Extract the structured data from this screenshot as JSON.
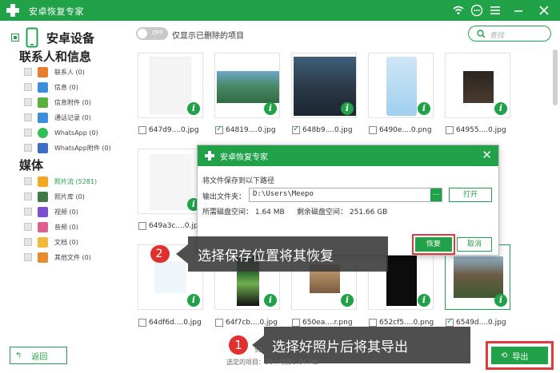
{
  "app": {
    "title": "安卓恢复专家"
  },
  "titlebar": {
    "icons": [
      "wifi-icon",
      "chat-icon",
      "menu-icon",
      "minimize-icon",
      "close-icon"
    ]
  },
  "sidebar": {
    "device_label": "安卓设备",
    "section1": "联系人和信息",
    "section2": "媒体",
    "contacts_items": [
      {
        "label": "联系人 (0)",
        "icon": "contacts-icon"
      },
      {
        "label": "信息 (0)",
        "icon": "message-icon"
      },
      {
        "label": "信息附件 (0)",
        "icon": "attachment-icon"
      },
      {
        "label": "通话记录 (0)",
        "icon": "call-log-icon"
      },
      {
        "label": "WhatsApp (0)",
        "icon": "whatsapp-icon"
      },
      {
        "label": "WhatsApp附件 (0)",
        "icon": "whatsapp-attachment-icon"
      }
    ],
    "media_items": [
      {
        "label": "照片流 (5281)",
        "icon": "photo-stream-icon"
      },
      {
        "label": "照片库 (0)",
        "icon": "photo-library-icon"
      },
      {
        "label": "视频 (0)",
        "icon": "video-icon"
      },
      {
        "label": "音频 (0)",
        "icon": "audio-icon"
      },
      {
        "label": "文档 (0)",
        "icon": "document-icon"
      },
      {
        "label": "其他文件 (0)",
        "icon": "other-files-icon"
      }
    ]
  },
  "filter": {
    "toggle_text": "OFF",
    "label": "仅显示已删除的项目"
  },
  "search": {
    "placeholder": "查找"
  },
  "thumbnails": [
    {
      "caption": "647d9....0.jpg",
      "checked": false
    },
    {
      "caption": "64819....0.jpg",
      "checked": true
    },
    {
      "caption": "648b9....0.jpg",
      "checked": true
    },
    {
      "caption": "6490e....0.png",
      "checked": false
    },
    {
      "caption": "64955....0.jpg",
      "checked": false
    },
    {
      "caption": "649a3c....0.jpg",
      "checked": false
    },
    {
      "caption": "64df6d....0.jpg",
      "checked": false
    },
    {
      "caption": "64f7cb....0.jpg",
      "checked": false
    },
    {
      "caption": "650ea....r.png",
      "checked": false
    },
    {
      "caption": "652cf5....0.png",
      "checked": false
    },
    {
      "caption": "6549d....0.jpg",
      "checked": true
    }
  ],
  "dialog": {
    "title": "安卓恢复专家",
    "prompt": "将文件保存到以下路径",
    "folder_label": "输出文件夹：",
    "folder_value": "D:\\Users\\Meepo",
    "browse_label": "...",
    "open_label": "打开",
    "required_space": "所需磁盘空间： 1.64 MB",
    "free_space": "剩余磁盘空间： 251.66 GB",
    "restore_label": "恢复",
    "cancel_label": "取消"
  },
  "annotations": {
    "step2": {
      "number": "2",
      "text": "选择保存位置将其恢复"
    },
    "step1": {
      "number": "1",
      "text": "选择好照片后将其导出"
    }
  },
  "footer": {
    "back_label": "返回",
    "count_fragment": "52",
    "selected_text": "选定的项目：28个项目1.64 MB",
    "export_label": "导出"
  },
  "colors": {
    "brand_green": "#21a249",
    "highlight_red": "#e03b3b",
    "annotation_bg": "#373737"
  }
}
